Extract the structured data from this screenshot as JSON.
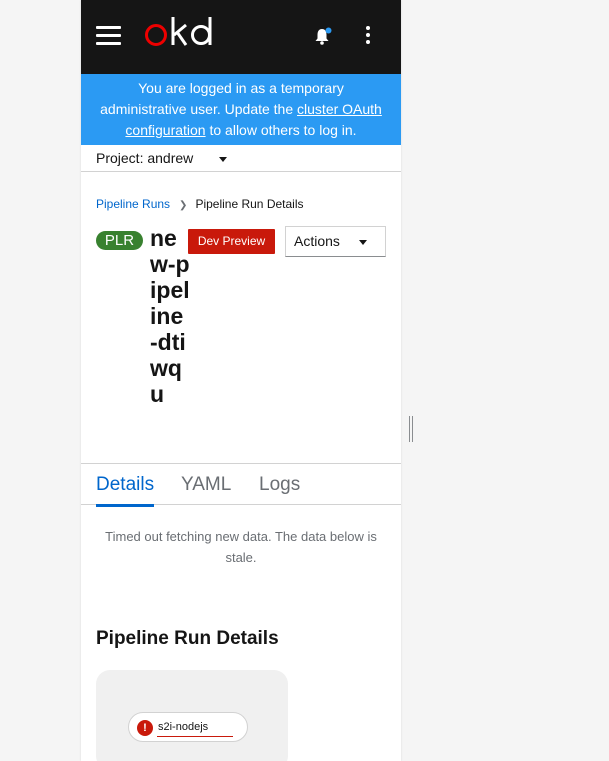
{
  "masthead": {
    "logo_text": "okd",
    "icons": {
      "menu": "hamburger-menu-icon",
      "notifications": "bell-icon",
      "more": "kebab-menu-icon"
    },
    "colors": {
      "background": "#151515",
      "logo_accent": "#ee0000",
      "notification_dot": "#2b9af3"
    }
  },
  "banner": {
    "text_before": "You are logged in as a temporary administrative user. Update the ",
    "link_text": "cluster OAuth configuration",
    "text_after": " to allow others to log in.",
    "color": "#2b9af3"
  },
  "project": {
    "label": "Project: andrew"
  },
  "breadcrumb": {
    "parent": "Pipeline Runs",
    "current": "Pipeline Run Details"
  },
  "header": {
    "badge": "PLR",
    "title": "new-pipeline-dtiwqu",
    "dev_preview": "Dev Preview",
    "actions_label": "Actions"
  },
  "tabs": [
    {
      "label": "Details",
      "active": true
    },
    {
      "label": "YAML",
      "active": false
    },
    {
      "label": "Logs",
      "active": false
    }
  ],
  "stale_message": "Timed out fetching new data. The data below is stale.",
  "section": {
    "title": "Pipeline Run Details"
  },
  "pipeline_graph": {
    "task": {
      "name": "s2i-nodejs",
      "status": "failed",
      "status_icon": "exclamation-circle-icon"
    }
  }
}
